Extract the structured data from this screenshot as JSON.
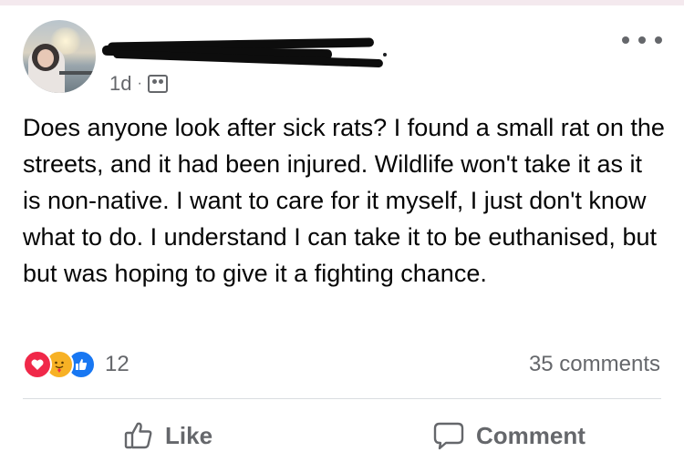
{
  "post": {
    "timestamp": "1d",
    "separator": "·",
    "audience_icon": "friends-audience-icon",
    "text": "Does anyone look after sick rats? I found a small rat on the streets, and it had been injured. Wildlife won't take it as it is non-native. I want to care for it myself, I just don't know what to do. I understand I can take it to be euthanised, but but was hoping to give it a fighting chance."
  },
  "engagement": {
    "reactions": [
      "love-reaction-icon",
      "care-reaction-icon",
      "like-reaction-icon"
    ],
    "reaction_count": "12",
    "comments_label": "35 comments"
  },
  "actions": {
    "like_label": "Like",
    "comment_label": "Comment"
  },
  "colors": {
    "secondary_text": "#65676b",
    "primary_text": "#050505",
    "love": "#f02849",
    "care": "#f7b125",
    "like": "#1877f2"
  }
}
